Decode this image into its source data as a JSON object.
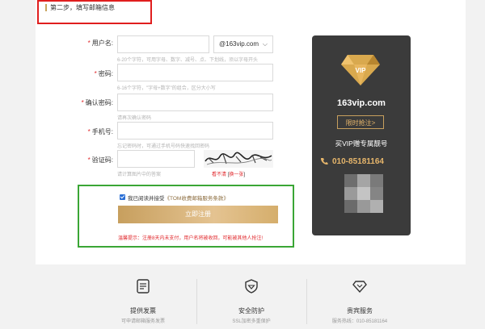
{
  "step": {
    "title": "第二步，填写邮箱信息"
  },
  "form": {
    "username": {
      "label": "用户名:",
      "hint": "6-20个字符，可用字母、数字、减号、点、下划线，须以字母开头"
    },
    "domain": {
      "value": "@163vip.com"
    },
    "password": {
      "label": "密码:",
      "hint": "6-16个字符，\"字母+数字\"的组合，区分大小写"
    },
    "confirm": {
      "label": "确认密码:",
      "hint": "请再次确认密码"
    },
    "phone": {
      "label": "手机号:",
      "hint": "忘记密码时，可通过手机号码快速找回密码"
    },
    "captcha": {
      "label": "验证码:",
      "hint": "请计算图片中的答案",
      "refresh_prefix": "看不清",
      "refresh_link": "换一张"
    },
    "agree": {
      "text": "我已阅读并接受",
      "link": "《TOM收费邮箱服务条款》"
    },
    "submit": "立即注册",
    "warning": "温馨提示：注册8天内未支付，用户名将被收回，可能被其他人抢注!"
  },
  "vip": {
    "domain": "163vip.com",
    "button": "限时抢注>",
    "promo": "买VIP赠专属靓号",
    "phone": "010-85181164",
    "colors": {
      "panel": "#3b3b3b",
      "gold": "#e7b66b"
    }
  },
  "footer": [
    {
      "icon": "invoice-icon",
      "title": "提供发票",
      "sub": "可申请邮箱服务发票"
    },
    {
      "icon": "shield-icon",
      "title": "安全防护",
      "sub": "SSL加密多重保护"
    },
    {
      "icon": "diamond-icon",
      "title": "贵宾服务",
      "sub": "服务热线：010-85181164"
    }
  ]
}
